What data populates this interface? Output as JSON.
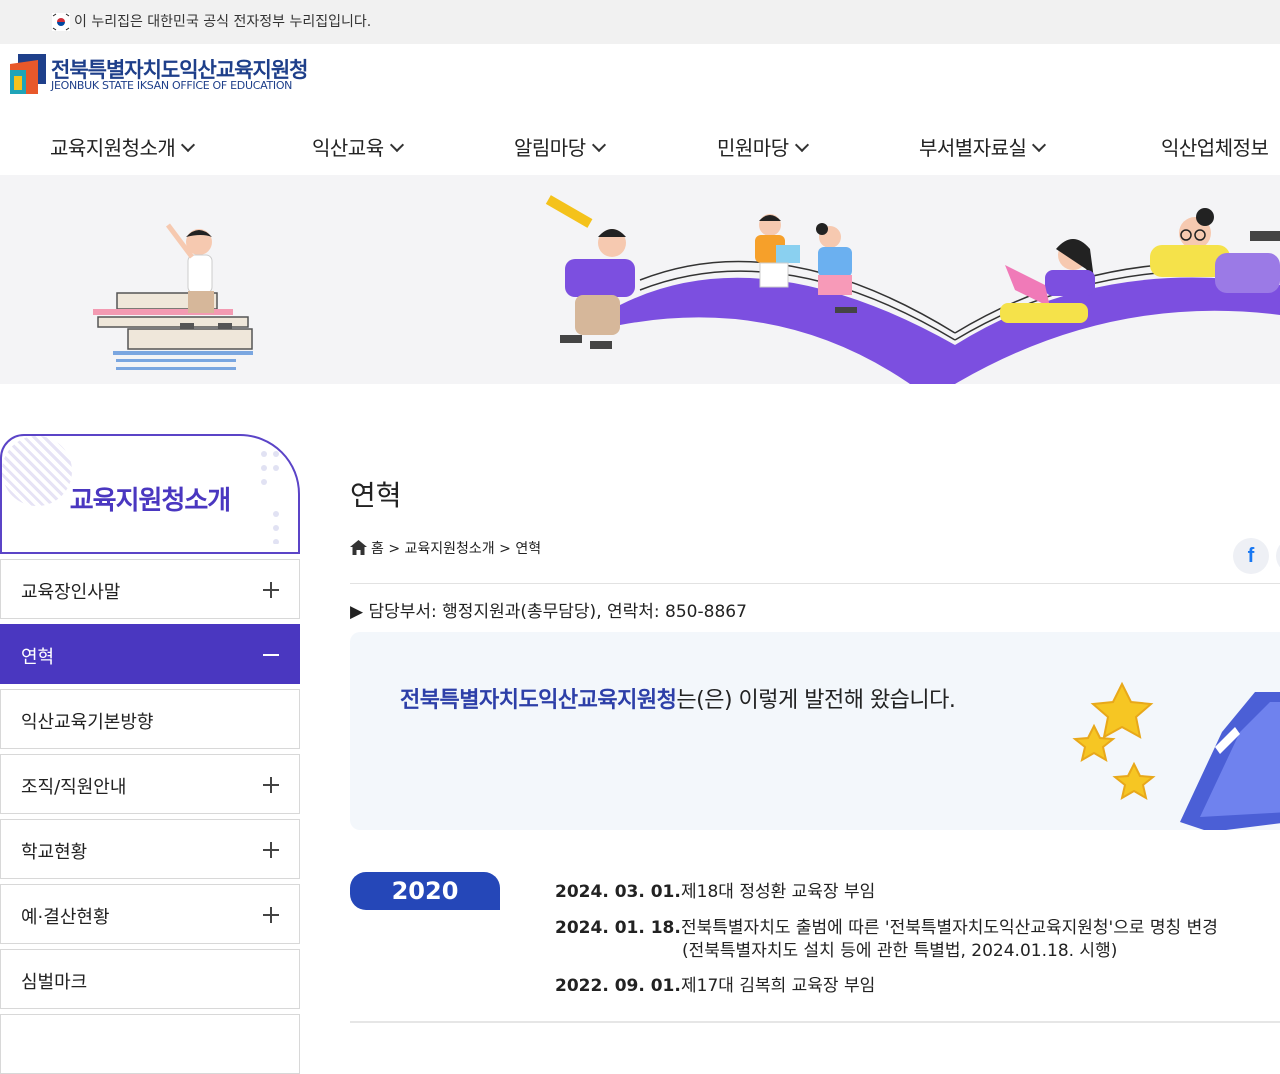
{
  "gov_notice": "이 누리집은 대한민국 공식 전자정부 누리집입니다.",
  "logo": {
    "name_ko": "전북특별자치도익산교육지원청",
    "name_en": "JEONBUK STATE IKSAN OFFICE OF EDUCATION"
  },
  "gnb": [
    "교육지원청소개",
    "익산교육",
    "알림마당",
    "민원마당",
    "부서별자료실",
    "익산업체정보"
  ],
  "sidebar": {
    "title": "교육지원청소개",
    "items": [
      {
        "label": "교육장인사말"
      },
      {
        "label": "연혁"
      },
      {
        "label": "익산교육기본방향"
      },
      {
        "label": "조직/직원안내"
      },
      {
        "label": "학교현황"
      },
      {
        "label": "예·결산현황"
      },
      {
        "label": "심벌마크"
      }
    ]
  },
  "page": {
    "title": "연혁",
    "breadcrumb": [
      "홈",
      "교육지원청소개",
      "연혁"
    ],
    "breadcrumb_sep": ">",
    "dept_info": "▶ 담당부서: 행정지원과(총무담당), 연락처: 850-8867",
    "intro_org": "전북특별자치도익산교육지원청",
    "intro_rest": "는(은) 이렇게 발전해 왔습니다.",
    "facebook": "f"
  },
  "history": {
    "year": "2020",
    "entries": [
      {
        "date": "2024. 03. 01.",
        "text": "제18대 정성환 교육장 부임",
        "sub": ""
      },
      {
        "date": "2024. 01. 18.",
        "text": "전북특별자치도 출범에 따른 '전북특별자치도익산교육지원청'으로 명칭 변경",
        "sub": "(전북특별자치도 설치 등에 관한 특별법, 2024.01.18. 시행)"
      },
      {
        "date": "2022. 09. 01.",
        "text": "제17대 김복희 교육장 부임",
        "sub": ""
      }
    ]
  },
  "colors": {
    "primary": "#4a37c0",
    "year_badge": "#2547b8",
    "logo": "#1e3f8a"
  }
}
